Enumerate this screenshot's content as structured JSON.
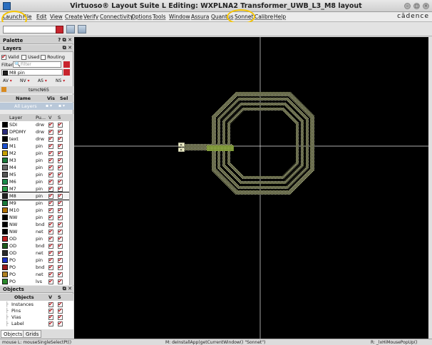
{
  "window": {
    "title": "Virtuoso® Layout Suite L Editing: WXPLNA2 Transformer_UWB_L3_M8 layout"
  },
  "menu": [
    "Launch",
    "File",
    "Edit",
    "View",
    "Create",
    "Verify",
    "Connectivity",
    "Options",
    "Tools",
    "Window",
    "Assura",
    "Quantus",
    "Sonnet",
    "Calibre",
    "Help"
  ],
  "brand": "cādence",
  "palette": {
    "title": "Palette",
    "layers_title": "Layers",
    "valid": "Valid",
    "used": "Used",
    "routing": "Routing",
    "filter_label": "Filter",
    "filter_placeholder": "Filter",
    "current_layer": "M8 pin",
    "vis_row": [
      "AV",
      "NV",
      "AS",
      "NS"
    ],
    "tech": "tsmcN65",
    "col_name": "Name",
    "col_vis": "Vis",
    "col_sel": "Sel",
    "all_layers": "All Layers",
    "layer_head": [
      "Layer",
      "Pu...",
      "V",
      "S"
    ],
    "layers": [
      {
        "name": "SDI",
        "purpose": "drw",
        "color": "#000000"
      },
      {
        "name": "DPDMY",
        "purpose": "drw",
        "color": "#2a2a7a"
      },
      {
        "name": "text",
        "purpose": "drw",
        "color": "#000000"
      },
      {
        "name": "M1",
        "purpose": "pin",
        "color": "#1a4fd0"
      },
      {
        "name": "M2",
        "purpose": "pin",
        "color": "#c8a000"
      },
      {
        "name": "M3",
        "purpose": "pin",
        "color": "#1a7a3a"
      },
      {
        "name": "M4",
        "purpose": "pin",
        "color": "#6a6a6a"
      },
      {
        "name": "M5",
        "purpose": "pin",
        "color": "#555555"
      },
      {
        "name": "M6",
        "purpose": "pin",
        "color": "#1a8a4a"
      },
      {
        "name": "M7",
        "purpose": "pin",
        "color": "#2aa04a"
      },
      {
        "name": "M8",
        "purpose": "pin",
        "color": "#202020"
      },
      {
        "name": "M9",
        "purpose": "pin",
        "color": "#1a7a3a"
      },
      {
        "name": "M10",
        "purpose": "pin",
        "color": "#b07000"
      },
      {
        "name": "NW",
        "purpose": "pin",
        "color": "#000000"
      },
      {
        "name": "NW",
        "purpose": "bnd",
        "color": "#000000"
      },
      {
        "name": "NW",
        "purpose": "net",
        "color": "#000000"
      },
      {
        "name": "OD",
        "purpose": "pin",
        "color": "#c02020"
      },
      {
        "name": "OD",
        "purpose": "bnd",
        "color": "#1a5a1a"
      },
      {
        "name": "OD",
        "purpose": "net",
        "color": "#2a2a2a"
      },
      {
        "name": "PO",
        "purpose": "pin",
        "color": "#1a30c0"
      },
      {
        "name": "PO",
        "purpose": "bnd",
        "color": "#9a1a1a"
      },
      {
        "name": "PO",
        "purpose": "net",
        "color": "#b08020"
      },
      {
        "name": "PO",
        "purpose": "lvs",
        "color": "#2a8a2a"
      }
    ],
    "selected_layer_index": 10
  },
  "objects": {
    "title": "Objects",
    "head": [
      "Objects",
      "V",
      "S"
    ],
    "items": [
      "Instances",
      "Pins",
      "Vias",
      "Label"
    ]
  },
  "tabs": [
    "Objects",
    "Grids"
  ],
  "status": {
    "left": "mouse L: mouseSingleSelectPt()",
    "mid": "M: deInstallApp(getCurrentWindow() \"Sonnet\")",
    "right": "R: _lxHiMousePopUp()"
  }
}
